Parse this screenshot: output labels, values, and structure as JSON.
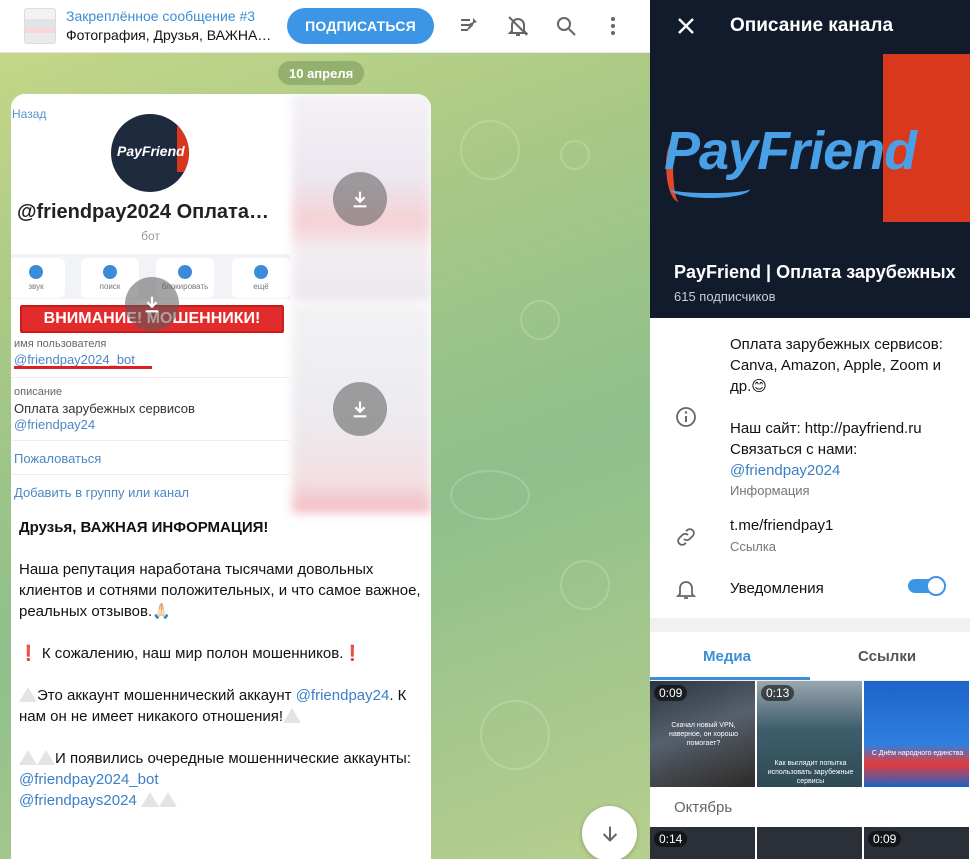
{
  "pinned": {
    "title": "Закреплённое сообщение #3",
    "preview": "Фотография, Друзья, ВАЖНА…"
  },
  "subscribe_label": "ПОДПИСАТЬСЯ",
  "date_label": "10 апреля",
  "screenshot": {
    "back": "Назад",
    "logo_text": "PayFriend",
    "bot_handle": "@friendpay2024 Оплата…",
    "bot_label": "бот",
    "actions": [
      "звук",
      "поиск",
      "блокировать",
      "ещё"
    ],
    "warning": "ВНИМАНИЕ! МОШЕННИКИ!",
    "username_label": "имя пользователя",
    "username": "@friendpay2024_bot",
    "description_label": "описание",
    "description": "Оплата зарубежных сервисов",
    "description_link": "@friendpay24",
    "report": "Пожаловаться",
    "add_to_group": "Добавить в группу или канал"
  },
  "message": {
    "headline": "Друзья, ВАЖНАЯ ИНФОРМАЦИЯ!",
    "p1": "Наша репутация наработана тысячами довольных клиентов и сотнями положительных, и что самое важное, реальных отзывов.🙏🏻",
    "p2": "К сожалению, наш мир полон мошенников.",
    "p3a": "Это аккаунт мошеннический аккаунт",
    "p3_link": "@friendpay24",
    "p3b": ". К нам он не имеет никакого отношения!",
    "p4": "И появились очередные мошеннические аккаунты:",
    "p4_link1": "@friendpay2024_bot",
    "p4_link2": "@friendpays2024"
  },
  "side": {
    "header_title": "Описание канала",
    "brand": "PayFriend",
    "channel_name": "PayFriend | Оплата зарубежных",
    "subscribers": "615 подписчиков",
    "desc1": "Оплата зарубежных сервисов: Canva, Amazon, Apple, Zoom и др.😊",
    "desc2": "Наш сайт: http://payfriend.ru",
    "desc3": "Связаться с нами:",
    "desc_link": "@friendpay2024",
    "info_label": "Информация",
    "link": "t.me/friendpay1",
    "link_label": "Ссылка",
    "notifications": "Уведомления",
    "notifications_on": true,
    "tabs": [
      "Медиа",
      "Ссылки"
    ],
    "tiles": [
      {
        "duration": "0:09",
        "caption": "Скачал новый VPN, наверное, он хорошо помогает?"
      },
      {
        "duration": "0:13",
        "caption": "Как выглядит попытка использовать зарубежные сервисы"
      },
      {
        "duration": "",
        "caption": "С Днём народного единства"
      }
    ],
    "month": "Октябрь",
    "tiles2": [
      {
        "duration": "0:14"
      },
      {
        "duration": ""
      },
      {
        "duration": "0:09"
      }
    ]
  },
  "colors": {
    "accent": "#3d95e6",
    "link": "#3a80c6",
    "warning": "#e32b2b",
    "hero_bg": "#121b2b",
    "brand_red": "#d8391c"
  },
  "icons": [
    "pin-list-icon",
    "bell-off-icon",
    "search-icon",
    "more-vert-icon",
    "download-icon",
    "arrow-down-icon",
    "close-icon",
    "info-icon",
    "link-icon",
    "bell-icon"
  ]
}
